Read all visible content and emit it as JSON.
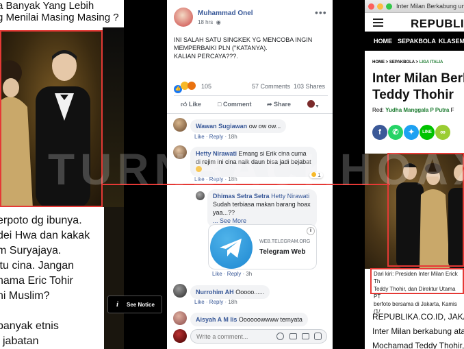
{
  "watermark": "TURNBACKHOAX",
  "left": {
    "headline": "a Banyak Yang Lebih\ng Menilai Masing Masing ?",
    "body": "erpoto dg ibunya.\ndei Hwa dan kakak\nm Suryajaya.\nitu cina. Jangan\nnama Eric Tohir\nni Muslim?\n\nbanyak etnis\ni jabatan"
  },
  "notice": {
    "icon": "i",
    "label": "See Notice"
  },
  "post": {
    "author": "Muhammad Onel",
    "time": "18 hrs",
    "text": "INI SALAH SATU SINGKEK YG MENCOBA INGIN MEMPERBAIKI PLN (\"KATANYA).\nKALIAN PERCAYA???.",
    "reactions_count": "105",
    "comments_count": "57 Comments",
    "shares_count": "103 Shares",
    "like": "Like",
    "comment": "Comment",
    "share": "Share"
  },
  "comments": [
    {
      "name": "Wawan Sugiawan",
      "text": "ow ow ow...",
      "like": "Like",
      "reply": "Reply",
      "time": "18h"
    },
    {
      "name": "Hetty Nirawati",
      "text": "Emang si Erik cina cuma di rejim ini cina naik daun bisa jadi bejabat",
      "like": "Like",
      "reply": "Reply",
      "time": "18h",
      "reaction_count": "1"
    },
    {
      "name": "Dhimas Setra Setra",
      "mention": "Hetty Nirawati",
      "text": "Sudah terbiasa makan barang hoax yaa...??",
      "see_more": "... See More",
      "link_domain": "WEB.TELEGRAM.ORG",
      "link_title": "Telegram Web",
      "like": "Like",
      "reply": "Reply",
      "time": "3h"
    },
    {
      "name": "Nurrohim AH",
      "text": "Ooooo......",
      "like": "Like",
      "reply": "Reply",
      "time": "18h"
    },
    {
      "name": "Aisyah A M Iis",
      "text": "Oooooowwww ternyata"
    }
  ],
  "composer": {
    "placeholder": "Write a comment..."
  },
  "republika": {
    "tab_title": "Inter Milan Berkabung un",
    "logo": "REPUBLI",
    "nav": [
      "HOME",
      "SEPAKBOLA",
      "KLASEM"
    ],
    "breadcrumb": [
      "HOME",
      "SEPAKBOLA",
      "LIGA ITALIA"
    ],
    "title": "Inter Milan Berk\nTeddy Thohir",
    "byline_prefix": "Red:",
    "byline_name": "Yudha Manggala P Putra",
    "byline_suffix": "F",
    "caption": "Dari kiri: Presiden Inter Milan Erick Th\nTeddy Thohir, dan Direktur Utama PT\nberfoto bersama di Jakarta, Kamis (1/",
    "body": "REPUBLIKA.CO.ID, JAKAR\nInter Milan berkabung atas\nMochamad Teddy Thohir, a"
  },
  "colors": {
    "accent_red": "#e53935",
    "fb_blue": "#385898",
    "republika_green": "#1a7a2e"
  }
}
